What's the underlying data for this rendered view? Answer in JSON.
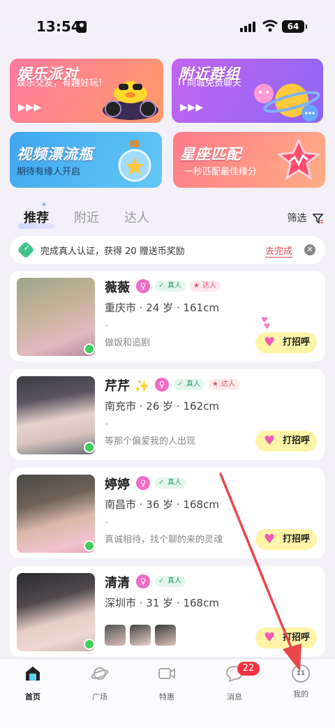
{
  "status_bar": {
    "time": "13:54",
    "battery": "64"
  },
  "banners": [
    {
      "title": "娱乐派对",
      "subtitle": "娱乐交友，有趣好玩!"
    },
    {
      "title": "附近群组",
      "subtitle": "同城免费聊天"
    },
    {
      "title": "视频漂流瓶",
      "subtitle": "期待有缘人开启"
    },
    {
      "title": "星座匹配",
      "subtitle": "一秒匹配最佳缘分"
    }
  ],
  "tabs": [
    {
      "label": "推荐"
    },
    {
      "label": "附近"
    },
    {
      "label": "达人"
    }
  ],
  "filter_label": "筛选",
  "verify": {
    "text": "完成真人认证，获得 20 赠送币奖励",
    "action": "去完成"
  },
  "badges": {
    "real": "真人",
    "expert": "达人"
  },
  "greet_label": "打招呼",
  "cards": [
    {
      "name": "薇薇",
      "meta": "重庆市 · 24 岁 · 161cm",
      "intro": "做饭和追剧"
    },
    {
      "name": "芹芹 ✨",
      "meta": "南充市 · 26 岁 · 162cm",
      "intro": "等那个偏爱我的人出现"
    },
    {
      "name": "婷婷",
      "meta": "南昌市 · 36 岁 · 168cm",
      "intro": "真诚相待，找个聊的来的灵魂"
    },
    {
      "name": "清清",
      "meta": "深圳市 · 31 岁 · 168cm",
      "intro": ""
    }
  ],
  "nav": [
    {
      "label": "首页",
      "icon": "home-icon"
    },
    {
      "label": "广场",
      "icon": "planet-icon"
    },
    {
      "label": "特惠",
      "icon": "video-icon"
    },
    {
      "label": "消息",
      "icon": "chat-icon"
    },
    {
      "label": "我的",
      "icon": "profile-icon"
    }
  ],
  "message_badge": "22",
  "profile_avatar_text": "11",
  "colors": {
    "accent_pink": "#f06bc4",
    "greet_yellow": "#fff4a8",
    "online_green": "#3ed05a",
    "annotation_arrow": "#e8474a"
  }
}
